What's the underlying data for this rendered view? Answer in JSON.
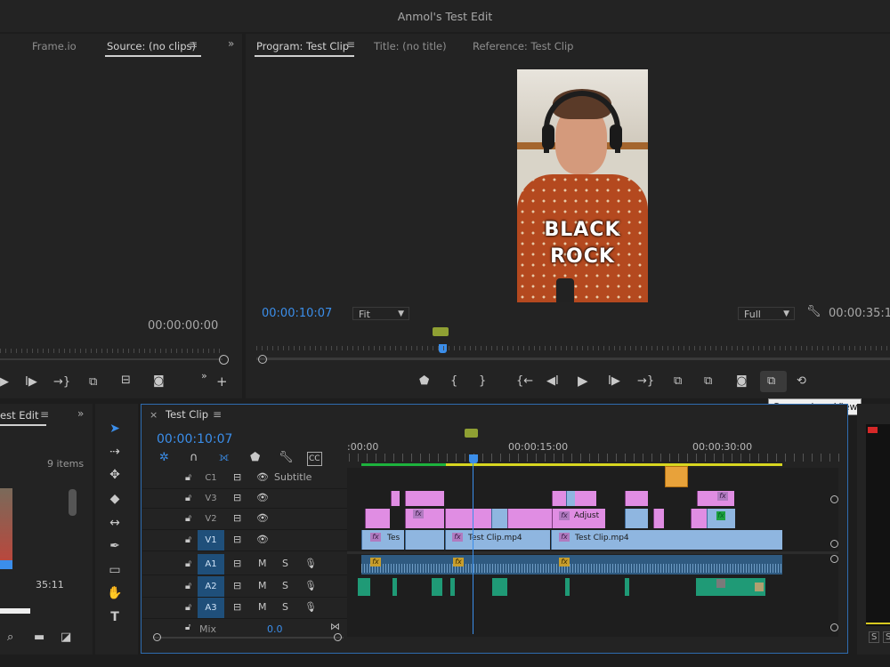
{
  "app": {
    "title": "Anmol's Test Edit"
  },
  "source_panel": {
    "tabs": [
      "Frame.io",
      "Source: (no clips)"
    ],
    "timecode": "00:00:00:00",
    "more": "»"
  },
  "program_panel": {
    "tabs": [
      "Program: Test Clip",
      "Title: (no title)",
      "Reference: Test Clip"
    ],
    "timecode_current": "00:00:10:07",
    "timecode_duration": "00:00:35:1",
    "fit_label": "Fit",
    "quality_label": "Full",
    "video_text_line1": "BLACK",
    "video_text_line2": "ROCK",
    "tooltip": "Comparison View"
  },
  "project_panel": {
    "tab": "est Edit",
    "more": "»",
    "item_count": "9 items",
    "thumb_duration": "35:11"
  },
  "timeline": {
    "tab": "Test Clip",
    "timecode": "00:00:10:07",
    "ruler_labels": [
      ":00:00",
      "00:00:15:00",
      "00:00:30:00"
    ],
    "tracks": [
      {
        "name": "C1",
        "extra": "Subtitle"
      },
      {
        "name": "V3"
      },
      {
        "name": "V2"
      },
      {
        "name": "V1"
      },
      {
        "name": "A1"
      },
      {
        "name": "A2"
      },
      {
        "name": "A3"
      }
    ],
    "mix_label": "Mix",
    "mix_value": "0.0",
    "m_label": "M",
    "s_label": "S",
    "clip_labels": {
      "tes": "Tes",
      "test_clip_1": "Test Clip.mp4",
      "test_clip_2": "Test Clip.mp4",
      "adjust": "Adjust"
    },
    "fx_label": "fx"
  },
  "meter": {
    "s1": "S",
    "s2": "S"
  },
  "colors": {
    "accent_blue": "#3b8eea",
    "v_clip_pink": "#e08de3",
    "v_clip_blue": "#8fb6e0",
    "audio_green": "#1f9a76"
  }
}
